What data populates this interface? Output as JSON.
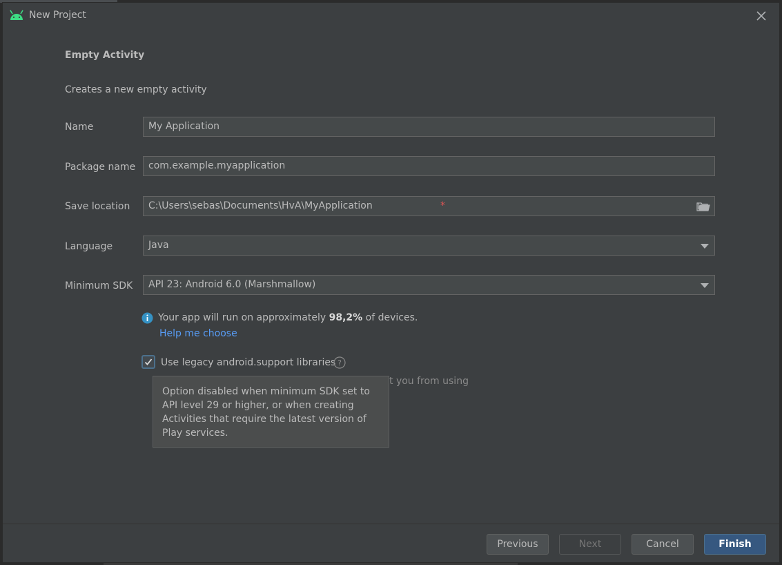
{
  "window": {
    "title": "New Project",
    "icon": "android-icon",
    "close_icon": "close-icon"
  },
  "template": {
    "heading": "Empty Activity",
    "description": "Creates a new empty activity"
  },
  "form": {
    "name": {
      "label": "Name",
      "value": "My Application"
    },
    "package": {
      "label": "Package name",
      "value": "com.example.myapplication"
    },
    "save_location": {
      "label": "Save location",
      "value": "C:\\Users\\sebas\\Documents\\HvA\\MyApplication",
      "required_marker": "*",
      "icon": "folder-icon"
    },
    "language": {
      "label": "Language",
      "value": "Java"
    },
    "min_sdk": {
      "label": "Minimum SDK",
      "value": "API 23: Android 6.0 (Marshmallow)"
    }
  },
  "info": {
    "prefix": "Your app will run on approximately ",
    "percent": "98,2%",
    "suffix": " of devices.",
    "help_link": "Help me choose"
  },
  "legacy": {
    "label": "Use legacy android.support libraries",
    "checked": true,
    "behind_text": "t you from using",
    "tooltip": "Option disabled when minimum SDK set to API level 29 or higher, or when creating Activities that require the latest version of Play services."
  },
  "buttons": {
    "previous": "Previous",
    "next": "Next",
    "cancel": "Cancel",
    "finish": "Finish"
  },
  "colors": {
    "background": "#3c3f41",
    "accent": "#365880",
    "link": "#589df6",
    "android": "#3ddc84",
    "required": "#e05555"
  }
}
